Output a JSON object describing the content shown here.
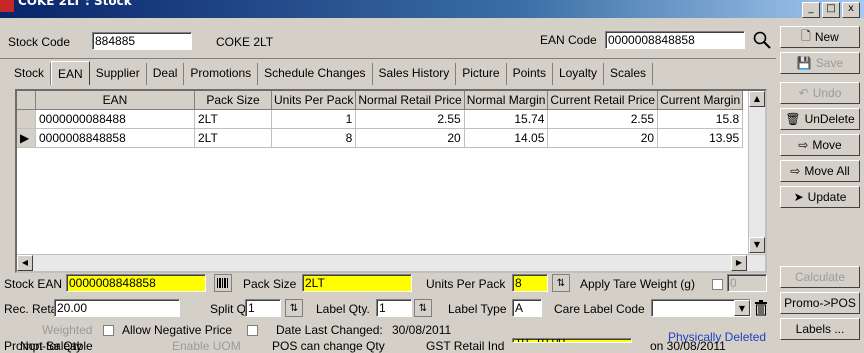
{
  "window": {
    "title": "COKE 2LT : Stock"
  },
  "header": {
    "stock_code_label": "Stock Code",
    "stock_code_value": "884885",
    "stock_desc": "COKE 2LT",
    "ean_code_label": "EAN Code",
    "ean_code_value": "0000008848858"
  },
  "tabs": [
    "Stock",
    "EAN",
    "Supplier",
    "Deal",
    "Promotions",
    "Schedule Changes",
    "Sales History",
    "Picture",
    "Points",
    "Loyalty",
    "Scales"
  ],
  "grid": {
    "columns": [
      "EAN",
      "Pack Size",
      "Units Per Pack",
      "Normal Retail Price",
      "Normal Margin",
      "Current Retail Price",
      "Current Margin"
    ],
    "rows": [
      [
        "0000000088488",
        "2LT",
        "1",
        "2.55",
        "15.74",
        "2.55",
        "15.8"
      ],
      [
        "0000008848858",
        "2LT",
        "8",
        "20",
        "14.05",
        "20",
        "13.95"
      ]
    ]
  },
  "form": {
    "stock_ean_label": "Stock EAN",
    "stock_ean_value": "0000008848858",
    "pack_size_label": "Pack Size",
    "pack_size_value": "2LT",
    "units_per_pack_label": "Units Per Pack",
    "units_per_pack_value": "8",
    "apply_tare_label": "Apply Tare Weight (g)",
    "apply_tare_value": "0",
    "rec_retail_label": "Rec. Retail",
    "rec_retail_value": "20.00",
    "split_qty_label": "Split Qty",
    "split_qty_value": "1",
    "label_qty_label": "Label Qty.",
    "label_qty_value": "1",
    "label_type_label": "Label Type",
    "label_type_value": "A",
    "care_label_label": "Care Label Code",
    "weighted_label": "Weighted",
    "allow_negative_label": "Allow Negative Price",
    "date_last_changed_label": "Date Last Changed:",
    "date_last_changed_value": "30/08/2011",
    "prompt_qty_label": "Prompt for Qty",
    "enable_uom_label": "Enable UOM",
    "pos_change_label": "POS can change Qty",
    "gst_label": "GST Retail Ind",
    "gst_value": "10: 10.00",
    "physically_deleted_label": "Physically Deleted",
    "deleted_on": "on 30/08/2011",
    "non_saleable_label": "Non-Saleable"
  },
  "actions": {
    "new": "New",
    "save": "Save",
    "undo": "Undo",
    "undelete": "UnDelete",
    "move": "Move",
    "move_all": "Move All",
    "update": "Update",
    "calculate": "Calculate",
    "promo_pos": "Promo->POS",
    "labels": "Labels ..."
  },
  "colors": {
    "highlight": "#ffff00",
    "titlebar": "#0a246a",
    "deleted_link": "#1f3fbf"
  }
}
